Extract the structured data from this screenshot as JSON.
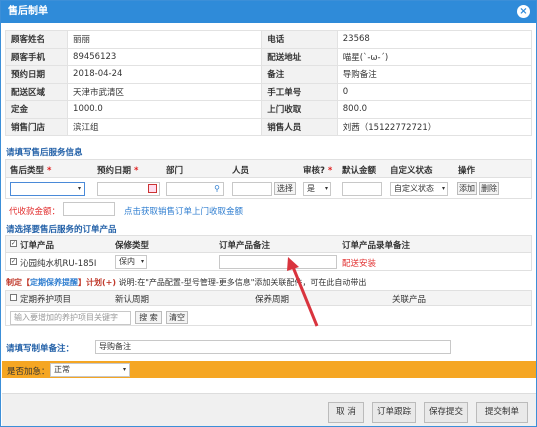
{
  "title": "售后制单",
  "info": [
    [
      "顾客姓名",
      "丽丽",
      "电话",
      "23568"
    ],
    [
      "顾客手机",
      "89456123",
      "配送地址",
      "喵星(`-ω-´)"
    ],
    [
      "预约日期",
      "2018-04-24",
      "备注",
      "导购备注"
    ],
    [
      "配送区域",
      "天津市武清区",
      "手工单号",
      "0"
    ],
    [
      "定金",
      "1000.0",
      "上门收取",
      "800.0"
    ],
    [
      "销售门店",
      "滨江组",
      "销售人员",
      "刘茜（15122772721）"
    ]
  ],
  "service": {
    "section": "请填写售后服务信息",
    "headers": {
      "type": "售后类型",
      "date": "预约日期",
      "dept": "部门",
      "person": "人员",
      "audit": "审核?",
      "amount": "默认金额",
      "custom_state": "自定义状态",
      "op": "操作"
    },
    "required_mark": "*",
    "select_btn": "选择",
    "audit_value": "是",
    "custom_state_value": "自定义状态",
    "add_btn": "添加",
    "del_btn": "删除",
    "code_label": "代收款金额：",
    "code_link": "点击获取销售订单上门收取金额"
  },
  "product": {
    "section": "请选择要售后服务的订单产品",
    "headers": {
      "product": "订单产品",
      "warranty": "保修类型",
      "note": "订单产品备注",
      "install_note": "订单产品录单备注"
    },
    "row": {
      "product": "沁园纯水机RU-185I",
      "warranty": "保内",
      "install": "配送安装"
    }
  },
  "plan": {
    "prefix": "制定【",
    "link": "定期保养提醒",
    "middle": "】计划(+)",
    "desc": "说明:在\"产品配置-型号管理-更多信息\"添加关联配件，可在此自动带出",
    "headers": {
      "item": "定期养护项目",
      "date": "新认周期",
      "period": "保养周期",
      "product": "关联产品"
    },
    "search_placeholder": "输入要增加的养护项目关键字",
    "search_btn": "搜 索",
    "clear_btn": "清空"
  },
  "remark": {
    "label": "请填写制单备注：",
    "value": "导购备注"
  },
  "urgent": {
    "label": "是否加急：",
    "value": "正常"
  },
  "footer": {
    "cancel": "取 消",
    "trace": "订单跟踪",
    "save": "保存提交",
    "create": "提交制单"
  },
  "colors": {
    "title_bar": "#2f8bd9",
    "urgent_bar": "#f5a623",
    "section": "#2361a8"
  }
}
